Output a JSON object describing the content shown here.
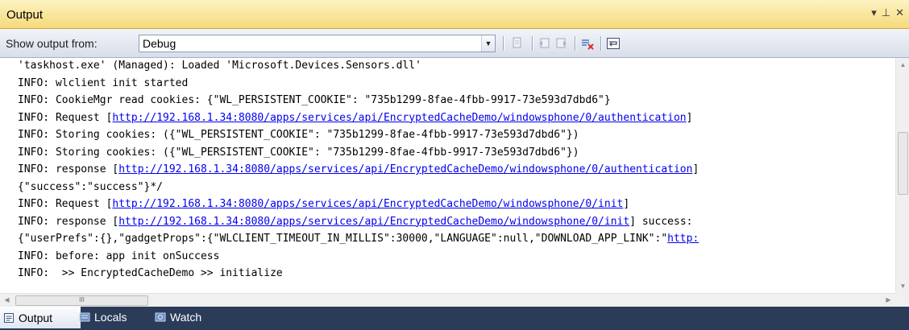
{
  "window": {
    "title": "Output",
    "controls": {
      "dropdown": "▾",
      "pin": "⊥",
      "close": "✕"
    }
  },
  "toolbar": {
    "show_output_label": "Show output from:",
    "source_select": {
      "value": "Debug"
    },
    "buttons": [
      "find-message-in-code-icon",
      "previous-message-icon",
      "next-message-icon",
      "clear-all-icon",
      "toggle-word-wrap-icon"
    ]
  },
  "output_lines": [
    {
      "pre": "'taskhost.exe' (Managed): Loaded 'Microsoft.Devices.Sensors.dll'",
      "link": "",
      "post": ""
    },
    {
      "pre": "INFO: wlclient init started",
      "link": "",
      "post": ""
    },
    {
      "pre": "INFO: CookieMgr read cookies: {\"WL_PERSISTENT_COOKIE\": \"735b1299-8fae-4fbb-9917-73e593d7dbd6\"}",
      "link": "",
      "post": ""
    },
    {
      "pre": "INFO: Request [",
      "link": "http://192.168.1.34:8080/apps/services/api/EncryptedCacheDemo/windowsphone/0/authentication",
      "post": "]"
    },
    {
      "pre": "INFO: Storing cookies: ({\"WL_PERSISTENT_COOKIE\": \"735b1299-8fae-4fbb-9917-73e593d7dbd6\"})",
      "link": "",
      "post": ""
    },
    {
      "pre": "INFO: Storing cookies: ({\"WL_PERSISTENT_COOKIE\": \"735b1299-8fae-4fbb-9917-73e593d7dbd6\"})",
      "link": "",
      "post": ""
    },
    {
      "pre": "INFO: response [",
      "link": "http://192.168.1.34:8080/apps/services/api/EncryptedCacheDemo/windowsphone/0/authentication",
      "post": "]"
    },
    {
      "pre": "{\"success\":\"success\"}*/",
      "link": "",
      "post": ""
    },
    {
      "pre": "INFO: Request [",
      "link": "http://192.168.1.34:8080/apps/services/api/EncryptedCacheDemo/windowsphone/0/init",
      "post": "]"
    },
    {
      "pre": "INFO: response [",
      "link": "http://192.168.1.34:8080/apps/services/api/EncryptedCacheDemo/windowsphone/0/init",
      "post": "] success:"
    },
    {
      "pre": "{\"userPrefs\":{},\"gadgetProps\":{\"WLCLIENT_TIMEOUT_IN_MILLIS\":30000,\"LANGUAGE\":null,\"DOWNLOAD_APP_LINK\":\"",
      "link": "http:",
      "post": ""
    },
    {
      "pre": "INFO: before: app init onSuccess",
      "link": "",
      "post": ""
    },
    {
      "pre": "INFO:  >> EncryptedCacheDemo >> initialize",
      "link": "",
      "post": ""
    }
  ],
  "scrollbar": {
    "h_thumb_grip": "III"
  },
  "tabs": [
    {
      "label": "Output",
      "icon": "output-window-icon",
      "active": true
    },
    {
      "label": "Locals",
      "icon": "locals-window-icon",
      "active": false
    },
    {
      "label": "Watch",
      "icon": "watch-window-icon",
      "active": false
    }
  ]
}
